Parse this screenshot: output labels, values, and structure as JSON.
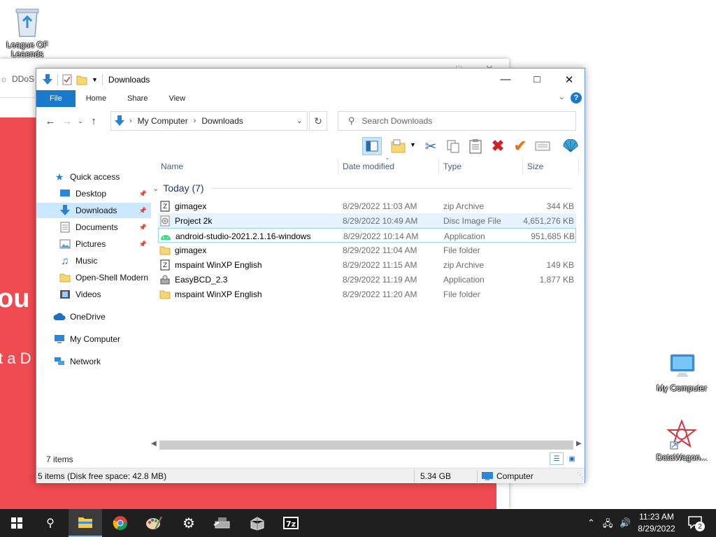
{
  "desktop": {
    "icons": [
      {
        "label": "League OF Leaends"
      },
      {
        "label": "My Computer"
      },
      {
        "label": "DataWagon..."
      }
    ]
  },
  "background_window": {
    "tab_label": "DDoS",
    "page_text_large": "ou h",
    "page_text_small": "t a D"
  },
  "explorer": {
    "title": "Downloads",
    "ribbon_tabs": [
      "File",
      "Home",
      "Share",
      "View"
    ],
    "address": {
      "crumbs": [
        "My Computer",
        "Downloads"
      ]
    },
    "search_placeholder": "Search Downloads",
    "columns": [
      "Name",
      "Date modified",
      "Type",
      "Size"
    ],
    "nav_pane": [
      {
        "label": "Quick access",
        "pinned": false
      },
      {
        "label": "Desktop",
        "pinned": true
      },
      {
        "label": "Downloads",
        "pinned": true,
        "selected": true
      },
      {
        "label": "Documents",
        "pinned": true
      },
      {
        "label": "Pictures",
        "pinned": true
      },
      {
        "label": "Music",
        "pinned": false
      },
      {
        "label": "Open-Shell Modern",
        "pinned": false
      },
      {
        "label": "Videos",
        "pinned": false
      },
      {
        "label": "OneDrive",
        "pinned": false
      },
      {
        "label": "My Computer",
        "pinned": false
      },
      {
        "label": "Network",
        "pinned": false
      }
    ],
    "group": {
      "label": "Today (7)"
    },
    "files": [
      {
        "name": "gimagex",
        "date": "8/29/2022 11:03 AM",
        "type": "zip Archive",
        "size": "344 KB",
        "icon": "zip-icon"
      },
      {
        "name": "Project 2k",
        "date": "8/29/2022 10:49 AM",
        "type": "Disc Image File",
        "size": "4,651,276 KB",
        "icon": "disc-image-icon"
      },
      {
        "name": "android-studio-2021.2.1.16-windows",
        "date": "8/29/2022 10:14 AM",
        "type": "Application",
        "size": "951,685 KB",
        "icon": "android-studio-icon"
      },
      {
        "name": "gimagex",
        "date": "8/29/2022 11:04 AM",
        "type": "File folder",
        "size": "",
        "icon": "folder-icon"
      },
      {
        "name": "mspaint WinXP English",
        "date": "8/29/2022 11:15 AM",
        "type": "zip Archive",
        "size": "149 KB",
        "icon": "zip-icon"
      },
      {
        "name": "EasyBCD_2.3",
        "date": "8/29/2022 11:19 AM",
        "type": "Application",
        "size": "1,877 KB",
        "icon": "installer-icon"
      },
      {
        "name": "mspaint WinXP English",
        "date": "8/29/2022 11:20 AM",
        "type": "File folder",
        "size": "",
        "icon": "folder-icon"
      }
    ],
    "item_count": "7 items",
    "status": {
      "left": "5 items (Disk free space: 42.8 MB)",
      "middle": "5.34 GB",
      "right": "Computer"
    }
  },
  "taskbar": {
    "time": "11:23 AM",
    "date": "8/29/2022",
    "notifications": "2"
  }
}
